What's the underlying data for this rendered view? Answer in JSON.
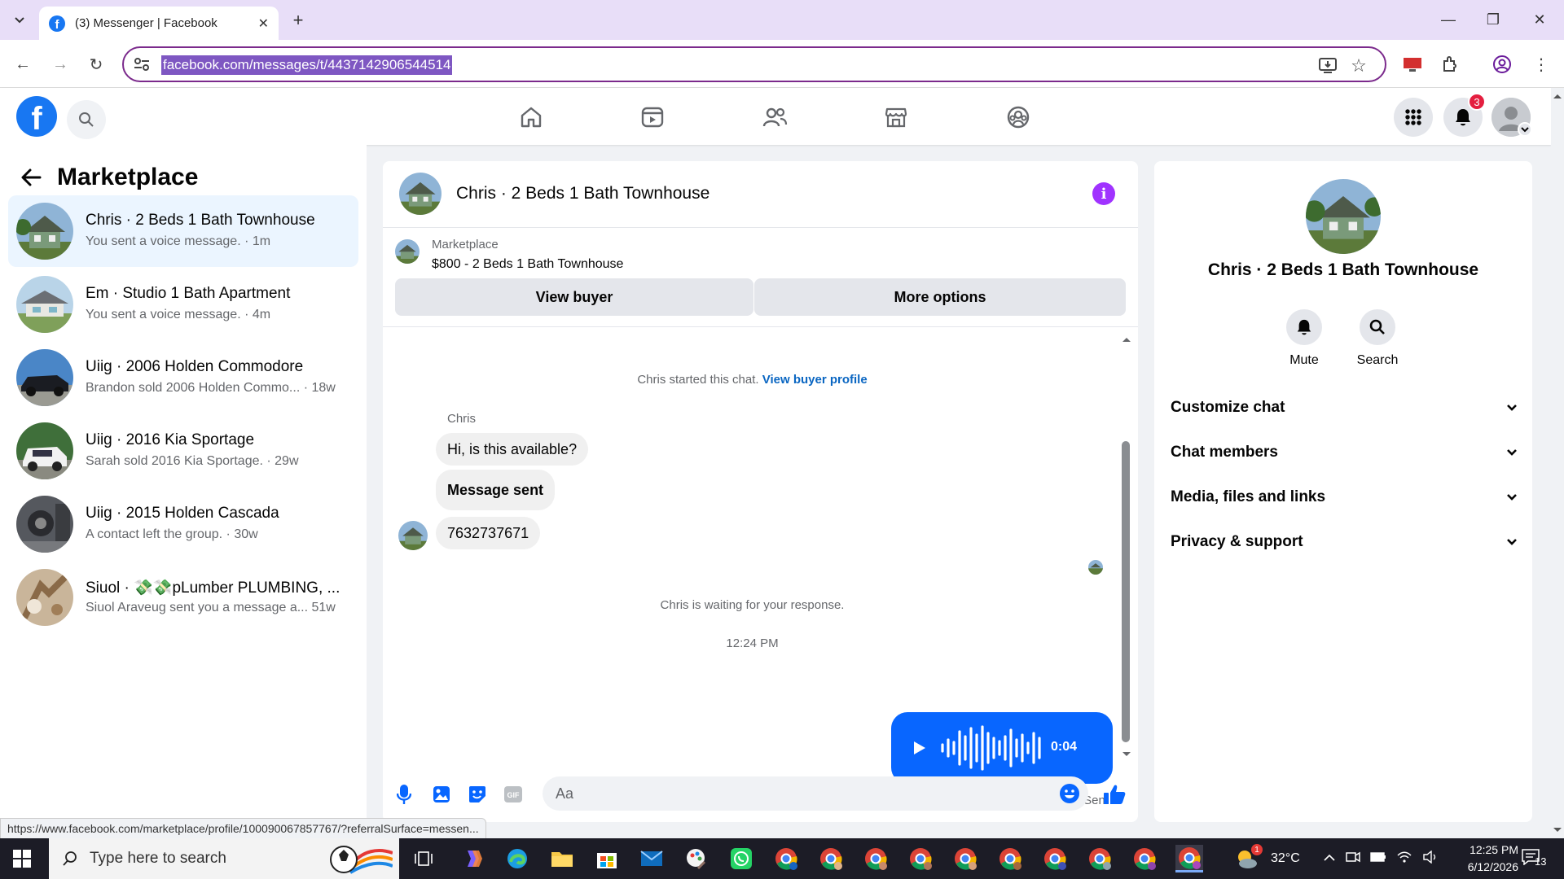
{
  "browser": {
    "tab_title": "(3) Messenger | Facebook",
    "url": "facebook.com/messages/t/4437142906544514",
    "status_url": "https://www.facebook.com/marketplace/profile/100090067857767/?referralSurface=messen..."
  },
  "header": {
    "notification_count": "3"
  },
  "left_pane": {
    "title": "Marketplace",
    "conversations": [
      {
        "name": "Chris · 2 Beds 1 Bath Townhouse",
        "sub": "You sent a voice message. · 1m",
        "active": true
      },
      {
        "name": "Em · Studio 1 Bath Apartment",
        "sub": "You sent a voice message. · 4m"
      },
      {
        "name": "Uiig · 2006 Holden Commodore",
        "sub": "Brandon sold 2006 Holden Commo...  · 18w"
      },
      {
        "name": "Uiig · 2016 Kia Sportage",
        "sub": "Sarah sold 2016 Kia Sportage. · 29w"
      },
      {
        "name": "Uiig · 2015 Holden Cascada",
        "sub": "A contact left the group. · 30w"
      },
      {
        "name": "Siuol · 💸💸pLumber PLUMBING, ...",
        "sub": "Siuol Araveug sent you a message a...   51w"
      }
    ]
  },
  "chat": {
    "title": "Chris · 2 Beds 1 Bath Townhouse",
    "listing_label": "Marketplace",
    "listing": "$800 - 2 Beds 1 Bath Townhouse",
    "view_buyer": "View buyer",
    "more_options": "More options",
    "started_text": "Chris started this chat.",
    "view_buyer_profile": "View buyer profile",
    "sender": "Chris",
    "messages": [
      "Hi, is this available?",
      "Message sent",
      "7632737671"
    ],
    "waiting_text": "Chris is waiting for your response.",
    "timestamp": "12:24 PM",
    "voice_duration": "0:04",
    "sent_label": "Sent",
    "composer_placeholder": "Aa"
  },
  "right_pane": {
    "title": "Chris · 2 Beds 1 Bath Townhouse",
    "mute": "Mute",
    "search": "Search",
    "sections": [
      "Customize chat",
      "Chat members",
      "Media, files and links",
      "Privacy & support"
    ]
  },
  "taskbar": {
    "search_placeholder": "Type here to search",
    "weather_badge": "1",
    "temperature": "32°C",
    "time": "12:25 PM",
    "date": "6/12/2026",
    "notification_count": "13"
  },
  "colors": {
    "fb_blue": "#1877f2",
    "messenger_blue": "#0866ff",
    "info_purple": "#a033ff",
    "url_highlight": "#7e57c2",
    "active_conv": "#ebf5ff"
  }
}
